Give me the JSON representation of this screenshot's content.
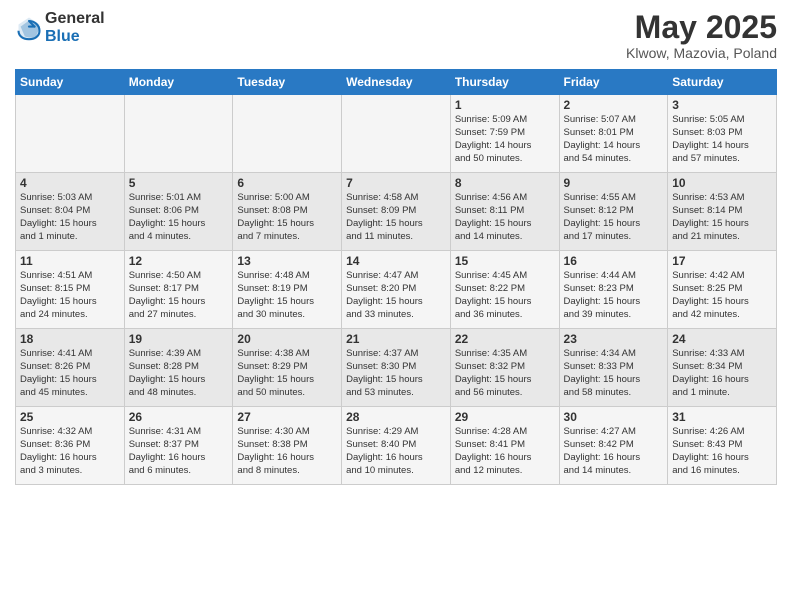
{
  "header": {
    "logo_general": "General",
    "logo_blue": "Blue",
    "month_title": "May 2025",
    "subtitle": "Klwow, Mazovia, Poland"
  },
  "days_of_week": [
    "Sunday",
    "Monday",
    "Tuesday",
    "Wednesday",
    "Thursday",
    "Friday",
    "Saturday"
  ],
  "weeks": [
    [
      {
        "day": "",
        "info": ""
      },
      {
        "day": "",
        "info": ""
      },
      {
        "day": "",
        "info": ""
      },
      {
        "day": "",
        "info": ""
      },
      {
        "day": "1",
        "info": "Sunrise: 5:09 AM\nSunset: 7:59 PM\nDaylight: 14 hours\nand 50 minutes."
      },
      {
        "day": "2",
        "info": "Sunrise: 5:07 AM\nSunset: 8:01 PM\nDaylight: 14 hours\nand 54 minutes."
      },
      {
        "day": "3",
        "info": "Sunrise: 5:05 AM\nSunset: 8:03 PM\nDaylight: 14 hours\nand 57 minutes."
      }
    ],
    [
      {
        "day": "4",
        "info": "Sunrise: 5:03 AM\nSunset: 8:04 PM\nDaylight: 15 hours\nand 1 minute."
      },
      {
        "day": "5",
        "info": "Sunrise: 5:01 AM\nSunset: 8:06 PM\nDaylight: 15 hours\nand 4 minutes."
      },
      {
        "day": "6",
        "info": "Sunrise: 5:00 AM\nSunset: 8:08 PM\nDaylight: 15 hours\nand 7 minutes."
      },
      {
        "day": "7",
        "info": "Sunrise: 4:58 AM\nSunset: 8:09 PM\nDaylight: 15 hours\nand 11 minutes."
      },
      {
        "day": "8",
        "info": "Sunrise: 4:56 AM\nSunset: 8:11 PM\nDaylight: 15 hours\nand 14 minutes."
      },
      {
        "day": "9",
        "info": "Sunrise: 4:55 AM\nSunset: 8:12 PM\nDaylight: 15 hours\nand 17 minutes."
      },
      {
        "day": "10",
        "info": "Sunrise: 4:53 AM\nSunset: 8:14 PM\nDaylight: 15 hours\nand 21 minutes."
      }
    ],
    [
      {
        "day": "11",
        "info": "Sunrise: 4:51 AM\nSunset: 8:15 PM\nDaylight: 15 hours\nand 24 minutes."
      },
      {
        "day": "12",
        "info": "Sunrise: 4:50 AM\nSunset: 8:17 PM\nDaylight: 15 hours\nand 27 minutes."
      },
      {
        "day": "13",
        "info": "Sunrise: 4:48 AM\nSunset: 8:19 PM\nDaylight: 15 hours\nand 30 minutes."
      },
      {
        "day": "14",
        "info": "Sunrise: 4:47 AM\nSunset: 8:20 PM\nDaylight: 15 hours\nand 33 minutes."
      },
      {
        "day": "15",
        "info": "Sunrise: 4:45 AM\nSunset: 8:22 PM\nDaylight: 15 hours\nand 36 minutes."
      },
      {
        "day": "16",
        "info": "Sunrise: 4:44 AM\nSunset: 8:23 PM\nDaylight: 15 hours\nand 39 minutes."
      },
      {
        "day": "17",
        "info": "Sunrise: 4:42 AM\nSunset: 8:25 PM\nDaylight: 15 hours\nand 42 minutes."
      }
    ],
    [
      {
        "day": "18",
        "info": "Sunrise: 4:41 AM\nSunset: 8:26 PM\nDaylight: 15 hours\nand 45 minutes."
      },
      {
        "day": "19",
        "info": "Sunrise: 4:39 AM\nSunset: 8:28 PM\nDaylight: 15 hours\nand 48 minutes."
      },
      {
        "day": "20",
        "info": "Sunrise: 4:38 AM\nSunset: 8:29 PM\nDaylight: 15 hours\nand 50 minutes."
      },
      {
        "day": "21",
        "info": "Sunrise: 4:37 AM\nSunset: 8:30 PM\nDaylight: 15 hours\nand 53 minutes."
      },
      {
        "day": "22",
        "info": "Sunrise: 4:35 AM\nSunset: 8:32 PM\nDaylight: 15 hours\nand 56 minutes."
      },
      {
        "day": "23",
        "info": "Sunrise: 4:34 AM\nSunset: 8:33 PM\nDaylight: 15 hours\nand 58 minutes."
      },
      {
        "day": "24",
        "info": "Sunrise: 4:33 AM\nSunset: 8:34 PM\nDaylight: 16 hours\nand 1 minute."
      }
    ],
    [
      {
        "day": "25",
        "info": "Sunrise: 4:32 AM\nSunset: 8:36 PM\nDaylight: 16 hours\nand 3 minutes."
      },
      {
        "day": "26",
        "info": "Sunrise: 4:31 AM\nSunset: 8:37 PM\nDaylight: 16 hours\nand 6 minutes."
      },
      {
        "day": "27",
        "info": "Sunrise: 4:30 AM\nSunset: 8:38 PM\nDaylight: 16 hours\nand 8 minutes."
      },
      {
        "day": "28",
        "info": "Sunrise: 4:29 AM\nSunset: 8:40 PM\nDaylight: 16 hours\nand 10 minutes."
      },
      {
        "day": "29",
        "info": "Sunrise: 4:28 AM\nSunset: 8:41 PM\nDaylight: 16 hours\nand 12 minutes."
      },
      {
        "day": "30",
        "info": "Sunrise: 4:27 AM\nSunset: 8:42 PM\nDaylight: 16 hours\nand 14 minutes."
      },
      {
        "day": "31",
        "info": "Sunrise: 4:26 AM\nSunset: 8:43 PM\nDaylight: 16 hours\nand 16 minutes."
      }
    ]
  ]
}
